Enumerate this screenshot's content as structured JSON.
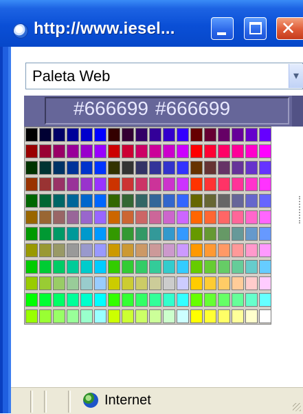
{
  "window": {
    "title": "http://www.iesel...",
    "controls": {
      "minimize": "minimize",
      "maximize": "maximize",
      "close": "✕"
    }
  },
  "palette_select": {
    "value": "Paleta Web"
  },
  "color_header": {
    "hex_primary": "#666699",
    "hex_secondary": "#666699",
    "color": "#666699"
  },
  "palette": {
    "rows": [
      [
        "#000000",
        "#000033",
        "#000066",
        "#000099",
        "#0000cc",
        "#0000ff",
        "#330000",
        "#330033",
        "#330066",
        "#330099",
        "#3300cc",
        "#3300ff",
        "#660000",
        "#660033",
        "#660066",
        "#660099",
        "#6600cc",
        "#6600ff"
      ],
      [
        "#990000",
        "#990033",
        "#990066",
        "#990099",
        "#9900cc",
        "#9900ff",
        "#cc0000",
        "#cc0033",
        "#cc0066",
        "#cc0099",
        "#cc00cc",
        "#cc00ff",
        "#ff0000",
        "#ff0033",
        "#ff0066",
        "#ff0099",
        "#ff00cc",
        "#ff00ff"
      ],
      [
        "#003300",
        "#003333",
        "#003366",
        "#003399",
        "#0033cc",
        "#0033ff",
        "#333300",
        "#333333",
        "#333366",
        "#333399",
        "#3333cc",
        "#3333ff",
        "#663300",
        "#663333",
        "#663366",
        "#663399",
        "#6633cc",
        "#6633ff"
      ],
      [
        "#993300",
        "#993333",
        "#993366",
        "#993399",
        "#9933cc",
        "#9933ff",
        "#cc3300",
        "#cc3333",
        "#cc3366",
        "#cc3399",
        "#cc33cc",
        "#cc33ff",
        "#ff3300",
        "#ff3333",
        "#ff3366",
        "#ff3399",
        "#ff33cc",
        "#ff33ff"
      ],
      [
        "#006600",
        "#006633",
        "#006666",
        "#006699",
        "#0066cc",
        "#0066ff",
        "#336600",
        "#336633",
        "#336666",
        "#336699",
        "#3366cc",
        "#3366ff",
        "#666600",
        "#666633",
        "#666666",
        "#666699",
        "#6666cc",
        "#6666ff"
      ],
      [
        "#996600",
        "#996633",
        "#996666",
        "#996699",
        "#9966cc",
        "#9966ff",
        "#cc6600",
        "#cc6633",
        "#cc6666",
        "#cc6699",
        "#cc66cc",
        "#cc66ff",
        "#ff6600",
        "#ff6633",
        "#ff6666",
        "#ff6699",
        "#ff66cc",
        "#ff66ff"
      ],
      [
        "#009900",
        "#009933",
        "#009966",
        "#009999",
        "#0099cc",
        "#0099ff",
        "#339900",
        "#339933",
        "#339966",
        "#339999",
        "#3399cc",
        "#3399ff",
        "#669900",
        "#669933",
        "#669966",
        "#669999",
        "#6699cc",
        "#6699ff"
      ],
      [
        "#999900",
        "#999933",
        "#999966",
        "#999999",
        "#9999cc",
        "#9999ff",
        "#cc9900",
        "#cc9933",
        "#cc9966",
        "#cc9999",
        "#cc99cc",
        "#cc99ff",
        "#ff9900",
        "#ff9933",
        "#ff9966",
        "#ff9999",
        "#ff99cc",
        "#ff99ff"
      ],
      [
        "#00cc00",
        "#00cc33",
        "#00cc66",
        "#00cc99",
        "#00cccc",
        "#00ccff",
        "#33cc00",
        "#33cc33",
        "#33cc66",
        "#33cc99",
        "#33cccc",
        "#33ccff",
        "#66cc00",
        "#66cc33",
        "#66cc66",
        "#66cc99",
        "#66cccc",
        "#66ccff"
      ],
      [
        "#99cc00",
        "#99cc33",
        "#99cc66",
        "#99cc99",
        "#99cccc",
        "#99ccff",
        "#cccc00",
        "#cccc33",
        "#cccc66",
        "#cccc99",
        "#cccccc",
        "#ccccff",
        "#ffcc00",
        "#ffcc33",
        "#ffcc66",
        "#ffcc99",
        "#ffcccc",
        "#ffccff"
      ],
      [
        "#00ff00",
        "#00ff33",
        "#00ff66",
        "#00ff99",
        "#00ffcc",
        "#00ffff",
        "#33ff00",
        "#33ff33",
        "#33ff66",
        "#33ff99",
        "#33ffcc",
        "#33ffff",
        "#66ff00",
        "#66ff33",
        "#66ff66",
        "#66ff99",
        "#66ffcc",
        "#66ffff"
      ],
      [
        "#99ff00",
        "#99ff33",
        "#99ff66",
        "#99ff99",
        "#99ffcc",
        "#99ffff",
        "#ccff00",
        "#ccff33",
        "#ccff66",
        "#ccff99",
        "#ccffcc",
        "#ccffff",
        "#ffff00",
        "#ffff33",
        "#ffff66",
        "#ffff99",
        "#ffffcc",
        "#ffffff"
      ]
    ]
  },
  "statusbar": {
    "zone_label": "Internet",
    "zone_icon": "globe-icon"
  }
}
